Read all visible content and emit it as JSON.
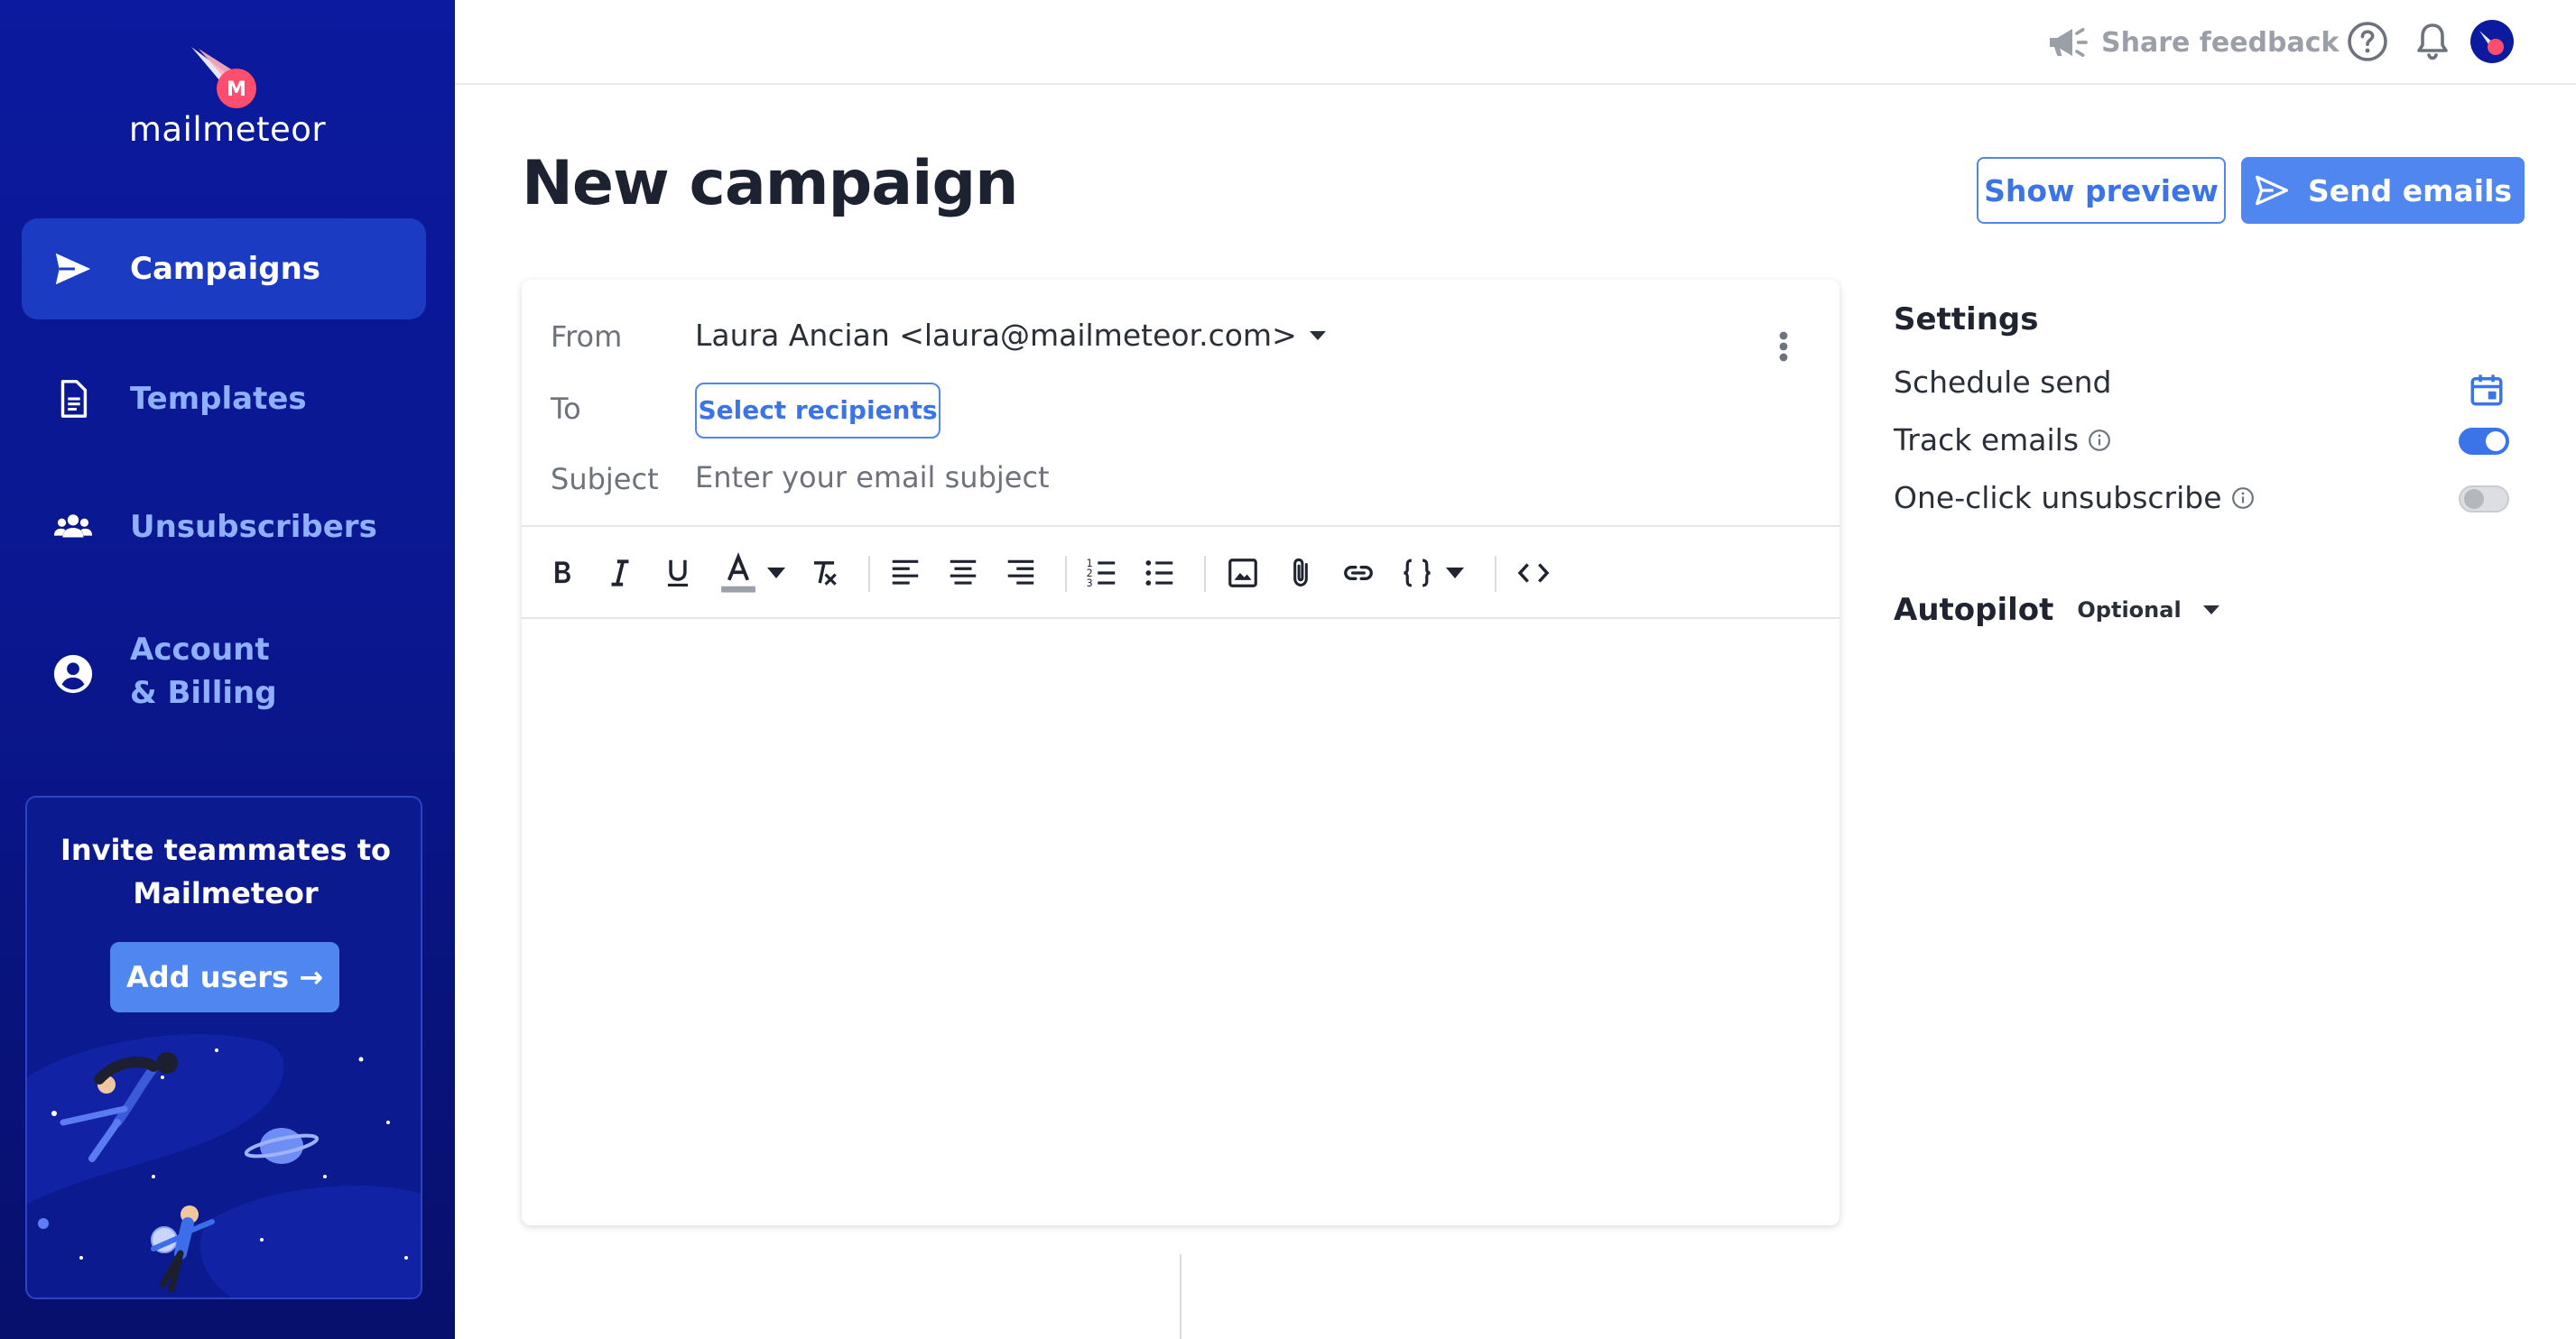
{
  "app": {
    "name": "mailmeteor"
  },
  "sidebar": {
    "items": [
      {
        "label": "Campaigns",
        "icon": "paper-plane-icon",
        "active": true
      },
      {
        "label": "Templates",
        "icon": "document-icon",
        "active": false
      },
      {
        "label": "Unsubscribers",
        "icon": "users-icon",
        "active": false
      },
      {
        "label_line1": "Account",
        "label_line2": "& Billing",
        "icon": "account-circle-icon",
        "active": false
      }
    ],
    "invite": {
      "title_line1": "Invite teammates to",
      "title_line2": "Mailmeteor",
      "button_label": "Add users →"
    }
  },
  "topbar": {
    "feedback_label": "Share feedback",
    "icons": [
      "megaphone-icon",
      "help-icon",
      "bell-icon",
      "avatar"
    ]
  },
  "page": {
    "title": "New campaign",
    "preview_label": "Show preview",
    "send_label": "Send emails"
  },
  "composer": {
    "from_label": "From",
    "from_value": "Laura Ancian <laura@mailmeteor.com>",
    "to_label": "To",
    "to_button": "Select recipients",
    "subject_label": "Subject",
    "subject_placeholder": "Enter your email subject",
    "subject_value": "",
    "toolbar": [
      "bold",
      "italic",
      "underline",
      "text-color",
      "clear-format",
      "align-left",
      "align-center",
      "align-right",
      "ordered-list",
      "bullet-list",
      "image",
      "attachment",
      "link",
      "variables",
      "code-view"
    ]
  },
  "settings": {
    "title": "Settings",
    "schedule_label": "Schedule send",
    "track_label": "Track emails",
    "track_enabled": true,
    "unsubscribe_label": "One-click unsubscribe",
    "unsubscribe_enabled": false,
    "autopilot_label": "Autopilot",
    "autopilot_value": "Optional"
  },
  "colors": {
    "sidebar": "#0b1a9e",
    "accent": "#4f86f0",
    "nav_text": "#8fb0ff"
  }
}
